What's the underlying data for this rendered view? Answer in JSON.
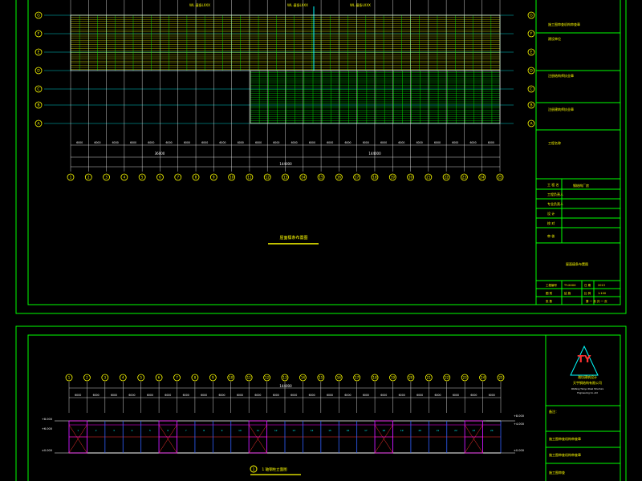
{
  "sheet1": {
    "plan_title": "屋面檩条布置图",
    "grid_cols": [
      "1",
      "2",
      "3",
      "4",
      "5",
      "6",
      "7",
      "8",
      "9",
      "10",
      "11",
      "12",
      "13",
      "14",
      "15",
      "16",
      "17",
      "18",
      "19",
      "20",
      "21",
      "22",
      "23",
      "24",
      "25"
    ],
    "grid_rows": [
      "G",
      "F",
      "E",
      "D",
      "C",
      "B",
      "A"
    ],
    "notes_top": [
      "WL 檩条LXXX",
      "WL 檩条LXXX",
      "WL 檩条LXXX"
    ],
    "dim_span": "6000",
    "dim_total_a": "36000",
    "dim_total_b": "144000",
    "title_block": {
      "rows": [
        "施工图审查机构审查章",
        "建设单位",
        "注册结构师执业章",
        "注册建筑师执业章",
        "工程名称"
      ],
      "project_label": "工程名称",
      "project_value": "钢结构厂房",
      "sign_rows": [
        "工 程 名",
        "工程负责人",
        "专业负责人",
        "设 计",
        "校 对",
        "审 核"
      ],
      "drawing_title": "屋面檩条布置图",
      "footer": [
        "工程编号",
        "TY-XXXX",
        "日 期",
        "2013",
        "图 别",
        "结 施",
        "比 例",
        "1:100",
        "张 数",
        "第 一 页 共 一 页"
      ]
    }
  },
  "sheet2": {
    "elevation_title": "1 轴钢柱立面图",
    "grid_cols": [
      "1",
      "2",
      "3",
      "4",
      "5",
      "6",
      "7",
      "8",
      "9",
      "10",
      "11",
      "12",
      "13",
      "14",
      "15",
      "16",
      "17",
      "18",
      "19",
      "20",
      "21",
      "22",
      "23",
      "24",
      "25"
    ],
    "dim_span": "6000",
    "dim_total": "144000",
    "levels": [
      "+8.000",
      "+6.000",
      "+4.000",
      "±0.000"
    ],
    "logo": {
      "mark": "TY",
      "company_cn": "潍坊建筑设计",
      "company_name": "天宇钢结构有限公司",
      "company_en1": "Weifang Tianyu Steel Structure",
      "company_en2": "Engineering Co.,Ltd"
    },
    "title_block": {
      "label": "备注：",
      "rows": [
        "施工图审查机构审查章",
        "施工图审查机构审查章",
        "施工图审查"
      ]
    }
  },
  "colors": {
    "frame": "#00ff00",
    "grid": "#00ffff",
    "purlin": "#ffff00",
    "dim": "#ffffff",
    "annot": "#00ff00",
    "col_mark": "#ff00ff",
    "red": "#ff3030",
    "blue": "#3060ff"
  }
}
